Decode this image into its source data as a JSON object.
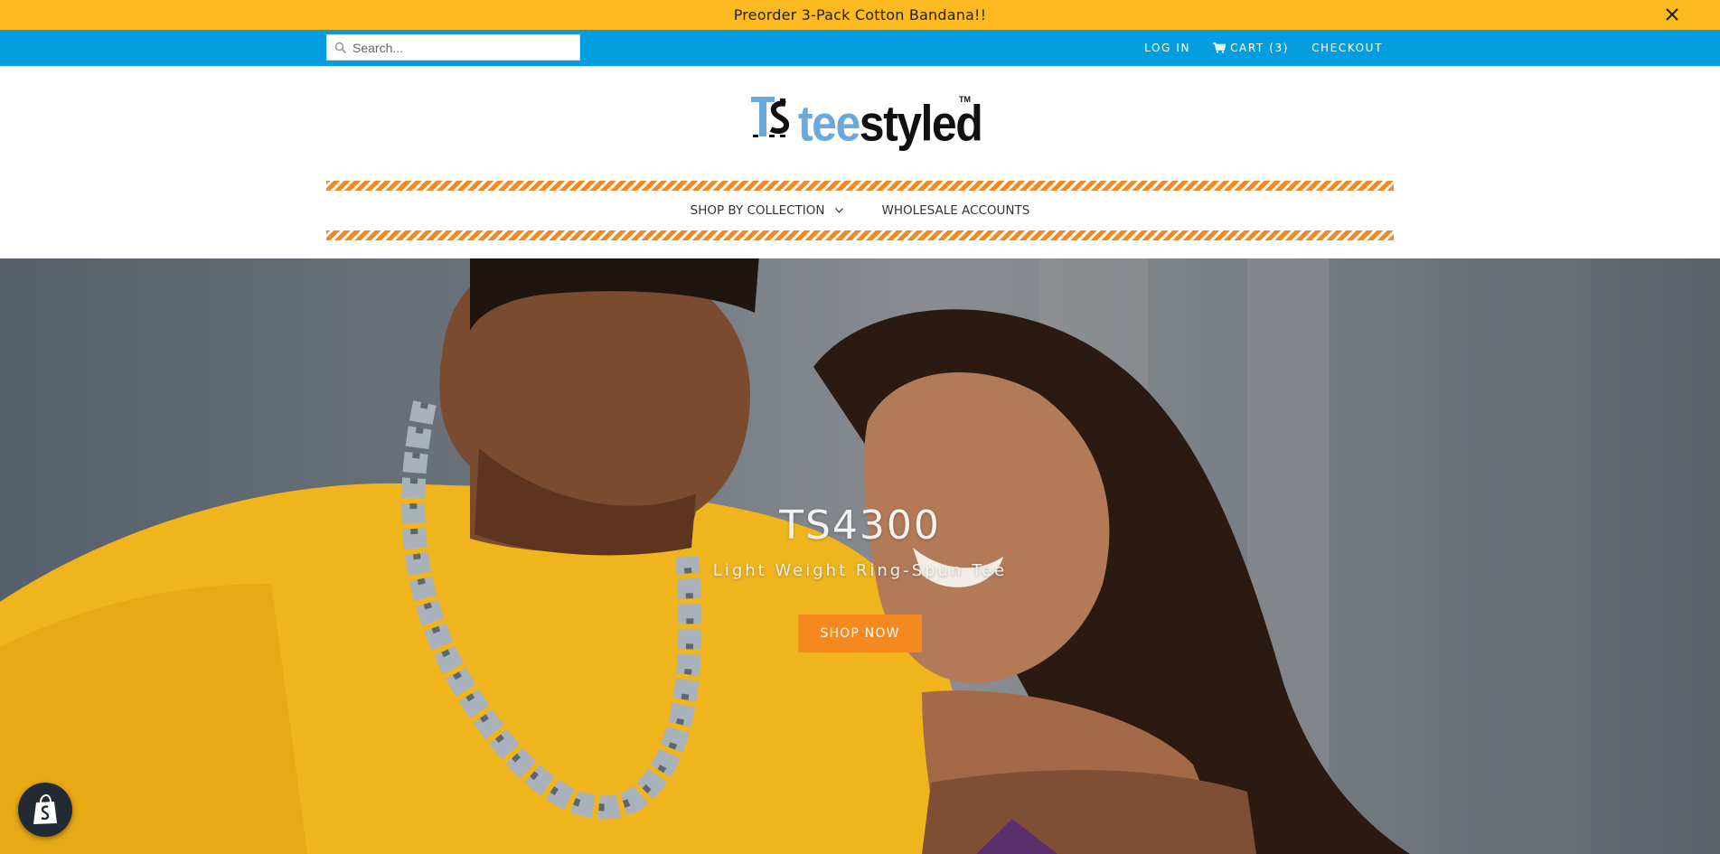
{
  "announcement": {
    "text": "Preorder 3-Pack Cotton Bandana!!",
    "close_icon": "close-icon"
  },
  "topbar": {
    "search": {
      "placeholder": "Search...",
      "value": "",
      "icon": "search-icon"
    },
    "links": {
      "login": "LOG IN",
      "cart": "CART (3)",
      "cart_icon": "cart-icon",
      "checkout": "CHECKOUT"
    }
  },
  "logo": {
    "mark": "TS",
    "tee": "tee",
    "styled": "styled",
    "tm": "TM"
  },
  "nav": {
    "items": [
      {
        "label": "SHOP BY COLLECTION",
        "icon": "chevron-down-icon"
      },
      {
        "label": "WHOLESALE ACCOUNTS"
      }
    ]
  },
  "hero": {
    "title": "TS4300",
    "subtitle": "Light Weight Ring-Spun Tee",
    "button": "SHOP NOW"
  },
  "badge": {
    "icon": "shopify-bag-icon"
  },
  "colors": {
    "announcement_bg": "#fdbb21",
    "topbar_bg": "#039ee0",
    "accent_orange": "#f5891f",
    "logo_blue": "#6ba8dd"
  }
}
